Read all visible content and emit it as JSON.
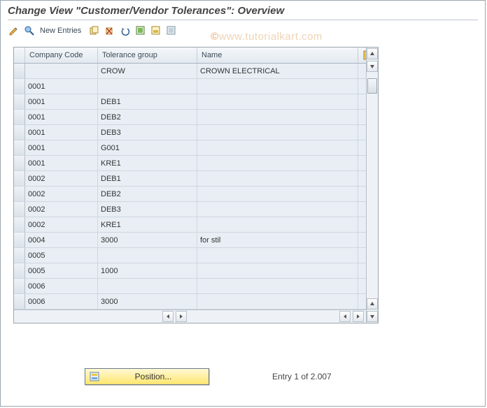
{
  "title": "Change View \"Customer/Vendor Tolerances\": Overview",
  "watermark_prefix": "©",
  "watermark": "www.tutorialkart.com",
  "toolbar": {
    "new_entries_label": "New Entries"
  },
  "table": {
    "headers": {
      "company_code": "Company Code",
      "tolerance_group": "Tolerance group",
      "name": "Name"
    },
    "rows": [
      {
        "company_code": "",
        "tolerance_group": "CROW",
        "name": "CROWN ELECTRICAL"
      },
      {
        "company_code": "0001",
        "tolerance_group": "",
        "name": ""
      },
      {
        "company_code": "0001",
        "tolerance_group": "DEB1",
        "name": ""
      },
      {
        "company_code": "0001",
        "tolerance_group": "DEB2",
        "name": ""
      },
      {
        "company_code": "0001",
        "tolerance_group": "DEB3",
        "name": ""
      },
      {
        "company_code": "0001",
        "tolerance_group": "G001",
        "name": ""
      },
      {
        "company_code": "0001",
        "tolerance_group": "KRE1",
        "name": ""
      },
      {
        "company_code": "0002",
        "tolerance_group": "DEB1",
        "name": ""
      },
      {
        "company_code": "0002",
        "tolerance_group": "DEB2",
        "name": ""
      },
      {
        "company_code": "0002",
        "tolerance_group": "DEB3",
        "name": ""
      },
      {
        "company_code": "0002",
        "tolerance_group": "KRE1",
        "name": ""
      },
      {
        "company_code": "0004",
        "tolerance_group": "3000",
        "name": "for stil"
      },
      {
        "company_code": "0005",
        "tolerance_group": "",
        "name": ""
      },
      {
        "company_code": "0005",
        "tolerance_group": "1000",
        "name": ""
      },
      {
        "company_code": "0006",
        "tolerance_group": "",
        "name": ""
      },
      {
        "company_code": "0006",
        "tolerance_group": "3000",
        "name": ""
      }
    ]
  },
  "footer": {
    "position_label": "Position...",
    "entry_label": "Entry 1 of 2.007"
  }
}
